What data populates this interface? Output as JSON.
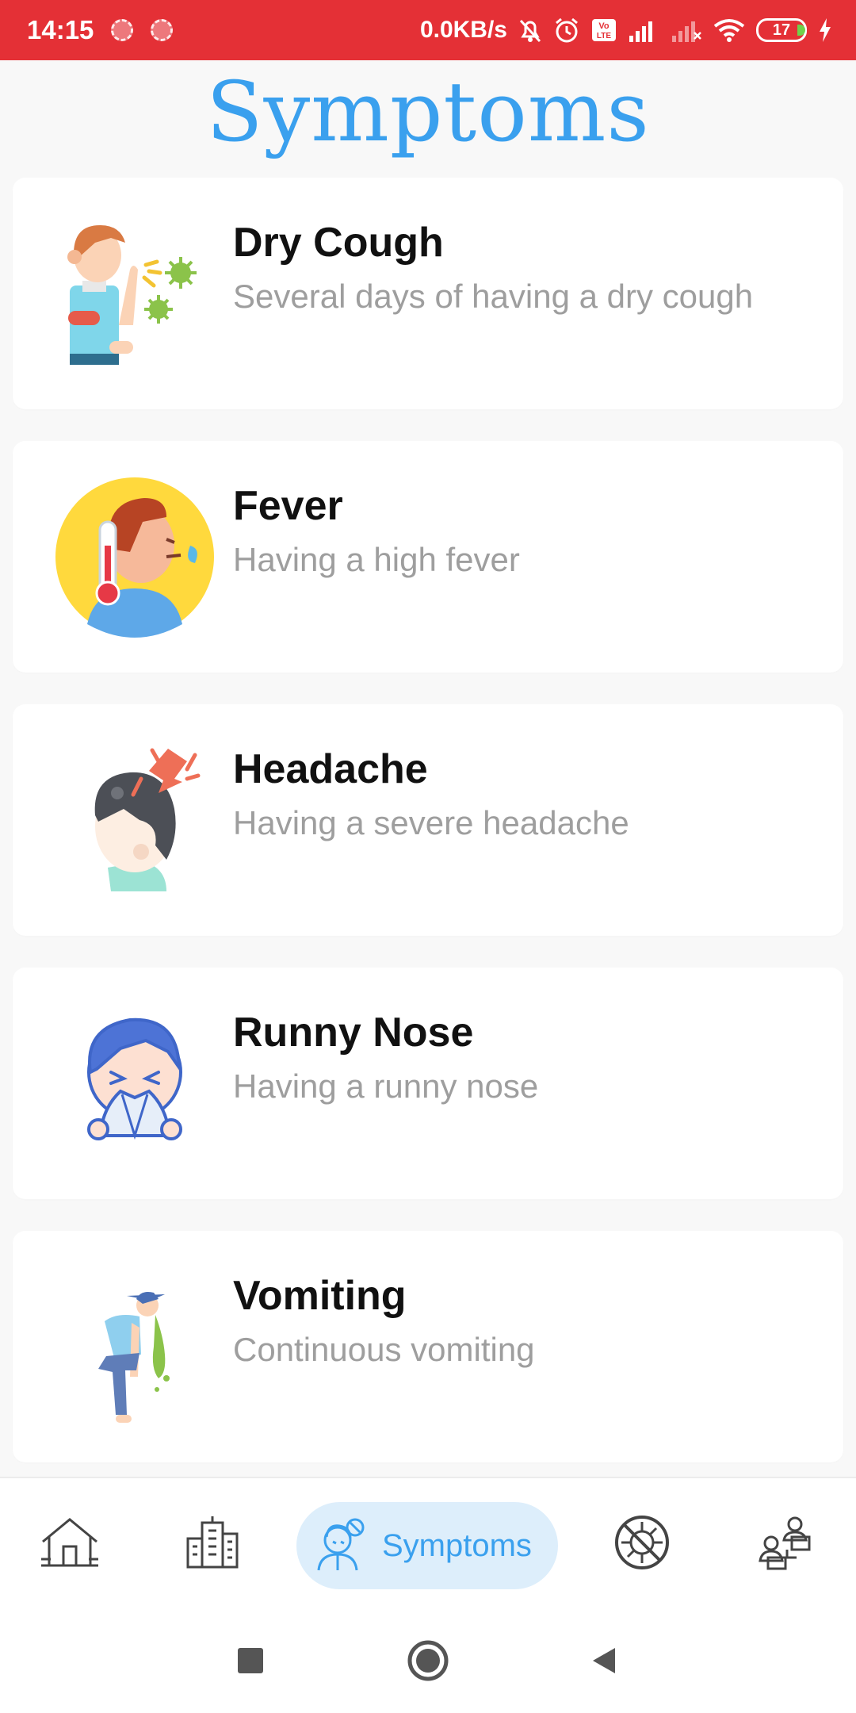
{
  "status_bar": {
    "time": "14:15",
    "network_speed": "0.0KB/s",
    "battery_level": "17",
    "icons": [
      "notification-dot-icon",
      "notification-dot-icon",
      "bell-off-icon",
      "alarm-icon",
      "volte-icon",
      "signal-icon",
      "signal-off-icon",
      "wifi-icon",
      "battery-icon",
      "charging-icon"
    ]
  },
  "page": {
    "title": "Symptoms"
  },
  "symptoms": [
    {
      "title": "Dry Cough",
      "description": "Several days of having a dry cough",
      "icon": "coughing-person-icon"
    },
    {
      "title": "Fever",
      "description": "Having a high fever",
      "icon": "fever-thermometer-icon"
    },
    {
      "title": "Headache",
      "description": "Having a severe headache",
      "icon": "headache-icon"
    },
    {
      "title": "Runny Nose",
      "description": "Having a runny nose",
      "icon": "runny-nose-icon"
    },
    {
      "title": "Vomiting",
      "description": "Continuous vomiting",
      "icon": "vomiting-person-icon"
    }
  ],
  "bottom_nav": {
    "items": [
      "home-icon",
      "buildings-icon",
      "symptoms-icon",
      "virus-prevention-icon",
      "doctors-icon"
    ],
    "active_label": "Symptoms"
  },
  "colors": {
    "status_bar": "#e43036",
    "accent": "#3aa0ee",
    "active_pill": "#ddeefb"
  }
}
